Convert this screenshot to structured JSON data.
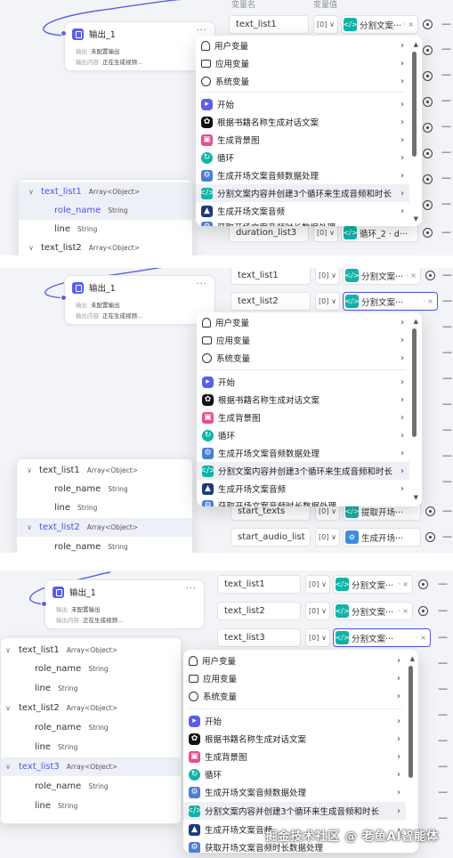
{
  "node": {
    "title": "输出_1",
    "more": "···",
    "row1_label": "输出",
    "row1_value": "未配置输出",
    "row2_label": "输出内容",
    "row2_value": "正在生成视频..."
  },
  "headers": {
    "name": "变量名",
    "value": "变量值"
  },
  "menu_items": [
    {
      "label": "用户变量",
      "icon": "user-icon"
    },
    {
      "label": "应用变量",
      "icon": "folder-icon"
    },
    {
      "label": "系统变量",
      "icon": "gear-icon"
    },
    {
      "label": "开始",
      "icon": "start-node-icon"
    },
    {
      "label": "根据书籍名称生成对话文案",
      "icon": "llm-node-icon"
    },
    {
      "label": "生成背景图",
      "icon": "image-node-icon"
    },
    {
      "label": "循环",
      "icon": "loop-node-icon"
    },
    {
      "label": "生成开场文案音频数据处理",
      "icon": "code-node-icon"
    },
    {
      "label": "分割文案内容并创建3个循环来生成音频和时长",
      "icon": "split-node-icon"
    },
    {
      "label": "生成开场文案音频",
      "icon": "audio-node-icon"
    },
    {
      "label": "获取开场文案音频时长数据处理",
      "icon": "code-node-icon"
    }
  ],
  "tree": {
    "text_list1": "text_list1",
    "text_list2": "text_list2",
    "text_list3": "text_list3",
    "role_name": "role_name",
    "line": "line",
    "type_array": "Array<Object>",
    "type_string": "String"
  },
  "panel1": {
    "rows": [
      {
        "name": "text_list1",
        "value": "分割文案···",
        "type": "[0]"
      },
      {
        "name": "duration_list3",
        "value": "循环_2 · d···",
        "type": "[0]"
      }
    ]
  },
  "panel2": {
    "rows": [
      {
        "name": "text_list1",
        "value": "分割文案···",
        "type": "[0]"
      },
      {
        "name": "text_list2",
        "value": "分割文案···",
        "type": "[0]"
      },
      {
        "name": "start_texts",
        "value": "提取开场···",
        "type": "[0]"
      },
      {
        "name": "start_audio_list",
        "value": "生成开场···",
        "type": "[0]"
      }
    ]
  },
  "panel3": {
    "rows": [
      {
        "name": "text_list1",
        "value": "分割文案···",
        "type": "[0]"
      },
      {
        "name": "text_list2",
        "value": "分割文案···",
        "type": "[0]"
      },
      {
        "name": "text_list3",
        "value": "分割文案···",
        "type": "[0]"
      }
    ]
  },
  "watermark": "掘金技术社区 @ 老鱼AI智能体"
}
